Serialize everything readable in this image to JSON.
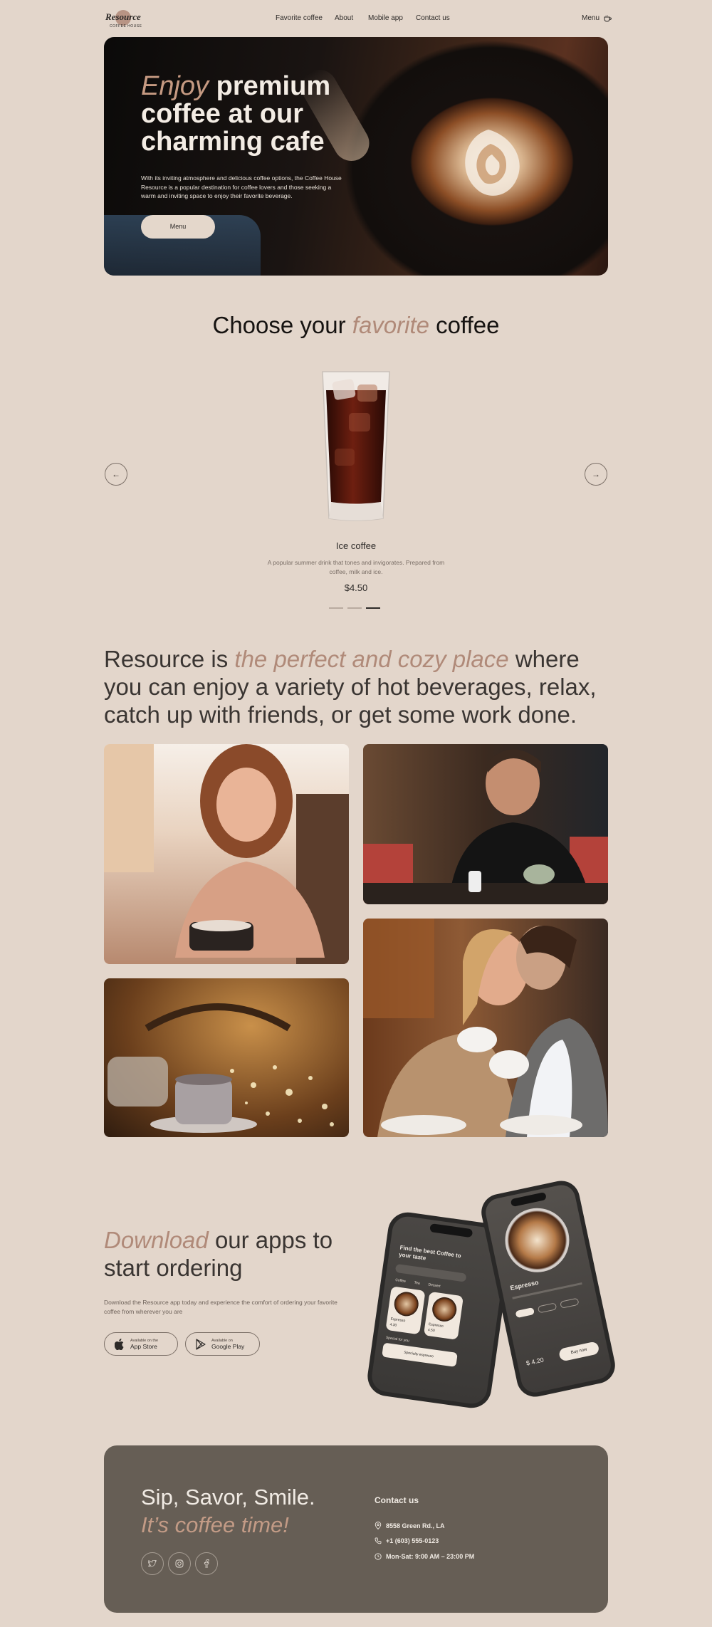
{
  "header": {
    "logo_text": "Resource",
    "logo_sub": "COFFEE HOUSE",
    "nav": [
      "Favorite coffee",
      "About",
      "Mobile app",
      "Contact us"
    ],
    "menu_label": "Menu",
    "menu_icon": "coffee-cup-icon"
  },
  "hero": {
    "title_em": "Enjoy",
    "title_rest": "premium coffee at our charming cafe",
    "description": "With its inviting atmosphere and delicious coffee options, the Coffee House Resource is a popular destination for coffee lovers and those seeking a warm and inviting space to enjoy their favorite beverage.",
    "button": "Menu"
  },
  "favorites": {
    "title_before": "Choose your",
    "title_em": "favorite",
    "title_after": "coffee",
    "product": {
      "name": "Ice coffee",
      "description": "A popular summer drink that tones and invigorates. Prepared from coffee, milk and ice.",
      "price": "$4.50"
    },
    "slides_total": 3,
    "slide_active": 3
  },
  "about": {
    "text_before": "Resource is",
    "text_em": "the perfect and cozy place",
    "text_after": "where you can enjoy a variety of hot beverages, relax, catch up with friends, or get some work done."
  },
  "apps": {
    "title_em": "Download",
    "title_rest": "our apps to start ordering",
    "description": "Download the Resource app today and experience the comfort of ordering your favorite coffee from wherever you are",
    "app_store": {
      "small": "Available on the",
      "big": "App Store"
    },
    "google_play": {
      "small": "Available on",
      "big": "Google Play"
    },
    "phone_left": {
      "heading": "Find the best Coffee to your taste",
      "tabs": [
        "Coffee",
        "Tea",
        "Dessert"
      ],
      "cards": [
        {
          "name": "Espresso",
          "price": "4.30"
        },
        {
          "name": "Espresso",
          "price": "4.50"
        }
      ],
      "special": "Special for you",
      "special_item": "Specialty espresso"
    },
    "phone_right": {
      "name": "Espresso",
      "price": "$ 4.20",
      "button": "Buy now"
    }
  },
  "footer": {
    "line1": "Sip, Savor, Smile.",
    "line2": "It’s coffee time!",
    "contact_title": "Contact us",
    "address": "8558 Green Rd., LA",
    "phone": "+1 (603) 555-0123",
    "hours": "Mon-Sat: 9:00 AM – 23:00 PM"
  },
  "colors": {
    "background": "#e3d6cb",
    "accent": "#b08a79",
    "text": "#2d2a28",
    "footer": "#665e55"
  }
}
